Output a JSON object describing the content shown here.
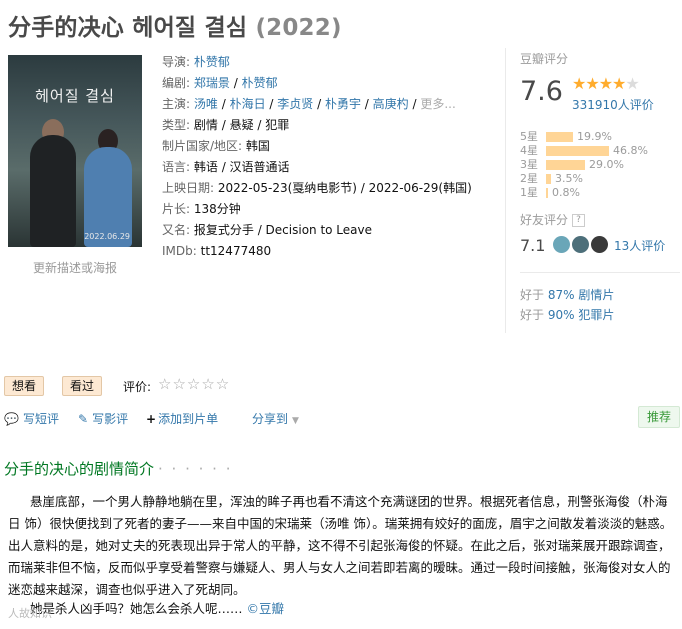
{
  "movie": {
    "title": "分手的决心 헤어질 결심",
    "year": "(2022)"
  },
  "poster": {
    "title": "헤어질 결심",
    "date": "2022.06.29",
    "update_link": "更新描述或海报"
  },
  "info": {
    "director_label": "导演:",
    "director": "朴赞郁",
    "writer_label": "编剧:",
    "writers": [
      "郑瑞景",
      "朴赞郁"
    ],
    "cast_label": "主演:",
    "cast": [
      "汤唯",
      "朴海日",
      "李贞贤",
      "朴勇宇",
      "高庚杓"
    ],
    "cast_more": "更多...",
    "genre_label": "类型:",
    "genres": [
      "剧情",
      "悬疑",
      "犯罪"
    ],
    "country_label": "制片国家/地区:",
    "country": "韩国",
    "language_label": "语言:",
    "language": "韩语 / 汉语普通话",
    "release_label": "上映日期:",
    "release": "2022-05-23(戛纳电影节) / 2022-06-29(韩国)",
    "runtime_label": "片长:",
    "runtime": "138分钟",
    "aka_label": "又名:",
    "aka": "报复式分手 / Decision to Leave",
    "imdb_label": "IMDb:",
    "imdb": "tt12477480"
  },
  "rating": {
    "label": "豆瓣评分",
    "score": "7.6",
    "stars_filled": 4,
    "stars_total": 5,
    "votes": "331910人评价",
    "distribution": [
      {
        "label": "5星",
        "value": 19.9,
        "text": "19.9%"
      },
      {
        "label": "4星",
        "value": 46.8,
        "text": "46.8%"
      },
      {
        "label": "3星",
        "value": 29.0,
        "text": "29.0%"
      },
      {
        "label": "2星",
        "value": 3.5,
        "text": "3.5%"
      },
      {
        "label": "1星",
        "value": 0.8,
        "text": "0.8%"
      }
    ],
    "friends_label": "好友评分",
    "friends_help": "?",
    "friends_score": "7.1",
    "friends_votes": "13人评价",
    "better1_prefix": "好于",
    "better1_pct": "87%",
    "better1_genre": "剧情片",
    "better2_prefix": "好于",
    "better2_pct": "90%",
    "better2_genre": "犯罪片"
  },
  "actions": {
    "want_label": "想看",
    "seen_label": "看过",
    "rate_label": "评价:",
    "rate_stars": "☆☆☆☆☆",
    "short_review": "写短评",
    "review": "写影评",
    "add_list": "添加到片单",
    "share": "分享到",
    "recommend": "推荐"
  },
  "summary": {
    "title": "分手的决心的剧情简介",
    "dots": "· · · · · ·",
    "text": "悬崖底部，一个男人静静地躺在里，浑浊的眸子再也看不清这个充满谜团的世界。根据死者信息，刑警张海俊（朴海日 饰）很快便找到了死者的妻子——来自中国的宋瑞莱（汤唯 饰）。瑞莱拥有姣好的面庞，眉宇之间散发着淡淡的魅惑。出人意料的是，她对丈夫的死表现出异于常人的平静，这不得不引起张海俊的怀疑。在此之后，张对瑞莱展开跟踪调查，而瑞莱非但不恼，反而似乎享受着警察与嫌疑人、男人与女人之间若即若离的暧昧。通过一段时间接触，张海俊对女人的迷恋越来越深，调查也似乎进入了死胡同。",
    "end": "她是杀人凶手吗？她怎么会杀人呢……",
    "source": "©豆瓣",
    "watermark": "人故知识"
  },
  "colors": {
    "link": "#3377aa",
    "star": "#ffac2d",
    "bar": "#ffd596",
    "green_title": "#007722"
  }
}
